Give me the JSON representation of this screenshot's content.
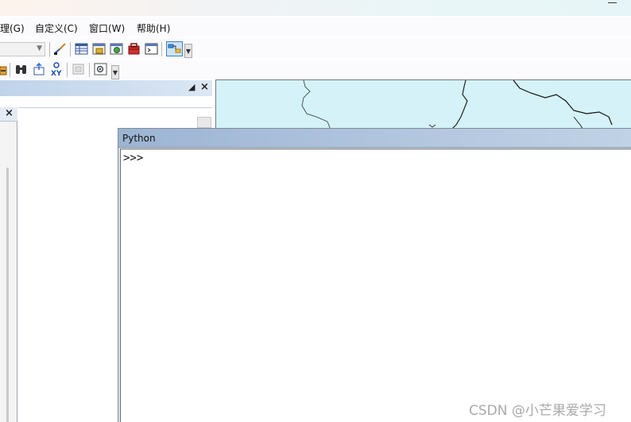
{
  "menu": {
    "items": [
      "理(G)",
      "自定义(C)",
      "窗口(W)",
      "帮助(H)"
    ]
  },
  "toolbar": {
    "icons": [
      "editor-icon",
      "table-icon",
      "catalog-icon",
      "search-window-icon",
      "arctoolbox-icon",
      "python-icon",
      "modelbuilder-icon"
    ],
    "row2_icons": [
      "identify-icon",
      "find-binoculars-icon",
      "go-to-xy-icon",
      "xy-icon",
      "html-popup-icon",
      "magnifier-icon"
    ]
  },
  "python_window": {
    "title": "Python",
    "prompt": ">>>"
  },
  "watermark": "CSDN @小芒果爱学习"
}
